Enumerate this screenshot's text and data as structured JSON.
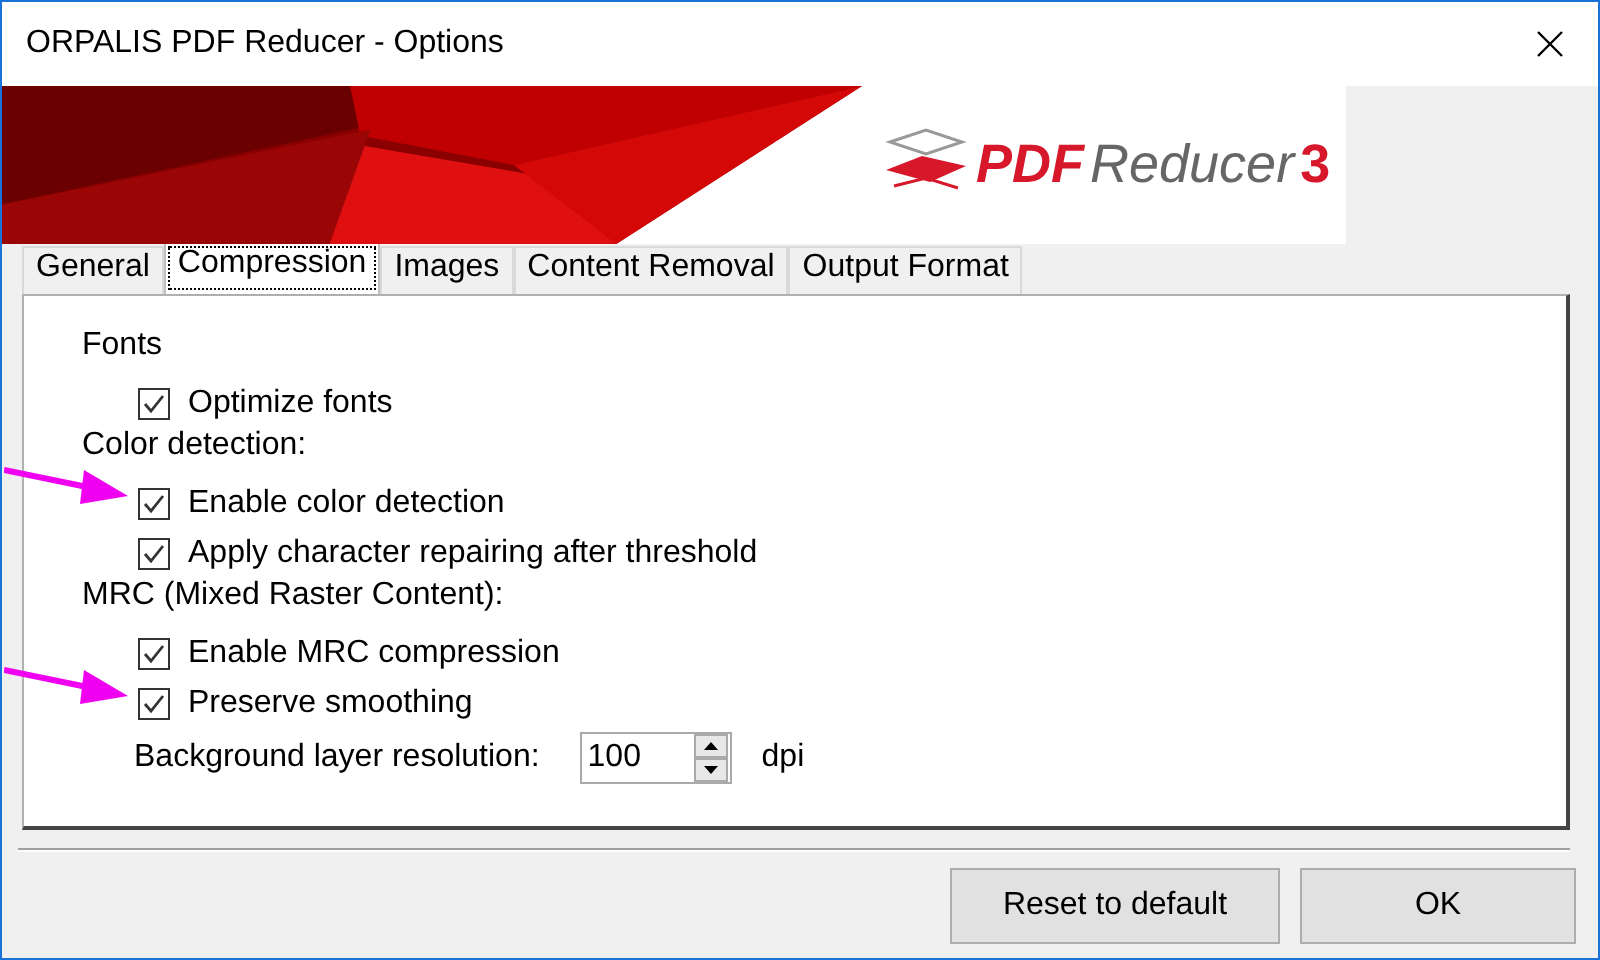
{
  "window": {
    "title": "ORPALIS PDF Reducer - Options"
  },
  "logo": {
    "brand": "PDF",
    "name": "Reducer",
    "version": "3"
  },
  "tabs": [
    {
      "label": "General",
      "selected": false
    },
    {
      "label": "Compression",
      "selected": true
    },
    {
      "label": "Images",
      "selected": false
    },
    {
      "label": "Content Removal",
      "selected": false
    },
    {
      "label": "Output Format",
      "selected": false
    }
  ],
  "sections": [
    {
      "heading": "Fonts",
      "options": [
        {
          "label": "Optimize fonts",
          "checked": true,
          "highlighted": false
        }
      ]
    },
    {
      "heading": "Color detection:",
      "options": [
        {
          "label": "Enable color detection",
          "checked": true,
          "highlighted": true
        },
        {
          "label": "Apply character repairing after threshold",
          "checked": true,
          "highlighted": false
        }
      ]
    },
    {
      "heading": "MRC (Mixed Raster Content):",
      "options": [
        {
          "label": "Enable MRC compression",
          "checked": true,
          "highlighted": false
        },
        {
          "label": "Preserve smoothing",
          "checked": true,
          "highlighted": true
        }
      ]
    }
  ],
  "resolution": {
    "label": "Background layer resolution:",
    "value": "100",
    "unit": "dpi"
  },
  "buttons": [
    "Reset to default",
    "OK"
  ]
}
